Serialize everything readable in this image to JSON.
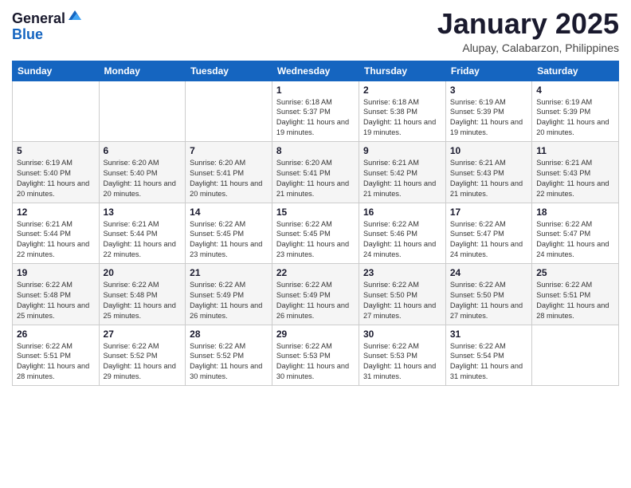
{
  "header": {
    "logo": {
      "general": "General",
      "blue": "Blue"
    },
    "title": "January 2025",
    "subtitle": "Alupay, Calabarzon, Philippines"
  },
  "calendar": {
    "days_of_week": [
      "Sunday",
      "Monday",
      "Tuesday",
      "Wednesday",
      "Thursday",
      "Friday",
      "Saturday"
    ],
    "weeks": [
      [
        {
          "day": "",
          "info": ""
        },
        {
          "day": "",
          "info": ""
        },
        {
          "day": "",
          "info": ""
        },
        {
          "day": "1",
          "info": "Sunrise: 6:18 AM\nSunset: 5:37 PM\nDaylight: 11 hours and 19 minutes."
        },
        {
          "day": "2",
          "info": "Sunrise: 6:18 AM\nSunset: 5:38 PM\nDaylight: 11 hours and 19 minutes."
        },
        {
          "day": "3",
          "info": "Sunrise: 6:19 AM\nSunset: 5:39 PM\nDaylight: 11 hours and 19 minutes."
        },
        {
          "day": "4",
          "info": "Sunrise: 6:19 AM\nSunset: 5:39 PM\nDaylight: 11 hours and 20 minutes."
        }
      ],
      [
        {
          "day": "5",
          "info": "Sunrise: 6:19 AM\nSunset: 5:40 PM\nDaylight: 11 hours and 20 minutes."
        },
        {
          "day": "6",
          "info": "Sunrise: 6:20 AM\nSunset: 5:40 PM\nDaylight: 11 hours and 20 minutes."
        },
        {
          "day": "7",
          "info": "Sunrise: 6:20 AM\nSunset: 5:41 PM\nDaylight: 11 hours and 20 minutes."
        },
        {
          "day": "8",
          "info": "Sunrise: 6:20 AM\nSunset: 5:41 PM\nDaylight: 11 hours and 21 minutes."
        },
        {
          "day": "9",
          "info": "Sunrise: 6:21 AM\nSunset: 5:42 PM\nDaylight: 11 hours and 21 minutes."
        },
        {
          "day": "10",
          "info": "Sunrise: 6:21 AM\nSunset: 5:43 PM\nDaylight: 11 hours and 21 minutes."
        },
        {
          "day": "11",
          "info": "Sunrise: 6:21 AM\nSunset: 5:43 PM\nDaylight: 11 hours and 22 minutes."
        }
      ],
      [
        {
          "day": "12",
          "info": "Sunrise: 6:21 AM\nSunset: 5:44 PM\nDaylight: 11 hours and 22 minutes."
        },
        {
          "day": "13",
          "info": "Sunrise: 6:21 AM\nSunset: 5:44 PM\nDaylight: 11 hours and 22 minutes."
        },
        {
          "day": "14",
          "info": "Sunrise: 6:22 AM\nSunset: 5:45 PM\nDaylight: 11 hours and 23 minutes."
        },
        {
          "day": "15",
          "info": "Sunrise: 6:22 AM\nSunset: 5:45 PM\nDaylight: 11 hours and 23 minutes."
        },
        {
          "day": "16",
          "info": "Sunrise: 6:22 AM\nSunset: 5:46 PM\nDaylight: 11 hours and 24 minutes."
        },
        {
          "day": "17",
          "info": "Sunrise: 6:22 AM\nSunset: 5:47 PM\nDaylight: 11 hours and 24 minutes."
        },
        {
          "day": "18",
          "info": "Sunrise: 6:22 AM\nSunset: 5:47 PM\nDaylight: 11 hours and 24 minutes."
        }
      ],
      [
        {
          "day": "19",
          "info": "Sunrise: 6:22 AM\nSunset: 5:48 PM\nDaylight: 11 hours and 25 minutes."
        },
        {
          "day": "20",
          "info": "Sunrise: 6:22 AM\nSunset: 5:48 PM\nDaylight: 11 hours and 25 minutes."
        },
        {
          "day": "21",
          "info": "Sunrise: 6:22 AM\nSunset: 5:49 PM\nDaylight: 11 hours and 26 minutes."
        },
        {
          "day": "22",
          "info": "Sunrise: 6:22 AM\nSunset: 5:49 PM\nDaylight: 11 hours and 26 minutes."
        },
        {
          "day": "23",
          "info": "Sunrise: 6:22 AM\nSunset: 5:50 PM\nDaylight: 11 hours and 27 minutes."
        },
        {
          "day": "24",
          "info": "Sunrise: 6:22 AM\nSunset: 5:50 PM\nDaylight: 11 hours and 27 minutes."
        },
        {
          "day": "25",
          "info": "Sunrise: 6:22 AM\nSunset: 5:51 PM\nDaylight: 11 hours and 28 minutes."
        }
      ],
      [
        {
          "day": "26",
          "info": "Sunrise: 6:22 AM\nSunset: 5:51 PM\nDaylight: 11 hours and 28 minutes."
        },
        {
          "day": "27",
          "info": "Sunrise: 6:22 AM\nSunset: 5:52 PM\nDaylight: 11 hours and 29 minutes."
        },
        {
          "day": "28",
          "info": "Sunrise: 6:22 AM\nSunset: 5:52 PM\nDaylight: 11 hours and 30 minutes."
        },
        {
          "day": "29",
          "info": "Sunrise: 6:22 AM\nSunset: 5:53 PM\nDaylight: 11 hours and 30 minutes."
        },
        {
          "day": "30",
          "info": "Sunrise: 6:22 AM\nSunset: 5:53 PM\nDaylight: 11 hours and 31 minutes."
        },
        {
          "day": "31",
          "info": "Sunrise: 6:22 AM\nSunset: 5:54 PM\nDaylight: 11 hours and 31 minutes."
        },
        {
          "day": "",
          "info": ""
        }
      ]
    ]
  }
}
